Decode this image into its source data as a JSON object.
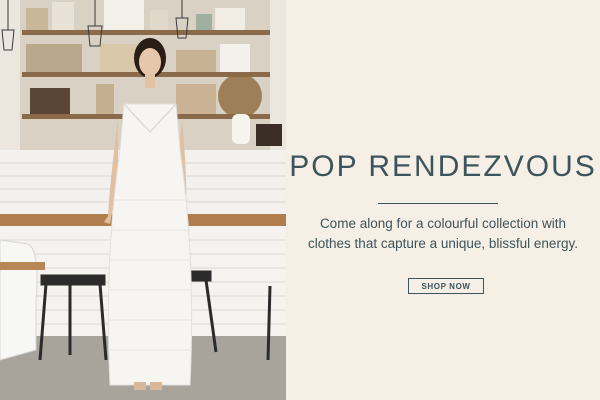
{
  "banner": {
    "title": "POP RENDEZVOUS",
    "description": "Come along for a colourful collection with clothes that capture a unique, blissful energy.",
    "cta_label": "SHOP NOW"
  },
  "colors": {
    "accent": "#3c545b",
    "panel_background": "#f5efe6"
  }
}
